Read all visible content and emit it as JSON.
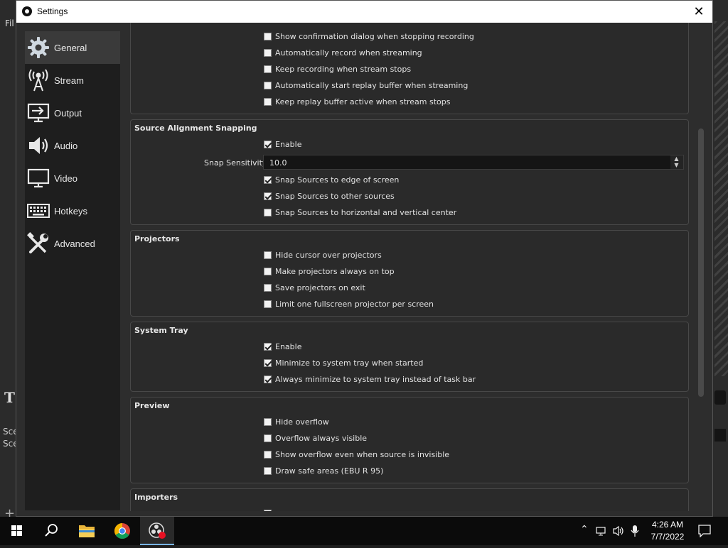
{
  "background_app": {
    "menu_fragment": "Fil",
    "scene_labels": [
      "Sce",
      "Sce"
    ],
    "text_tool_glyph": "T",
    "add_glyph": "+"
  },
  "window": {
    "title": "Settings",
    "close_glyph": "✕"
  },
  "sidebar": {
    "items": [
      {
        "label": "General",
        "icon": "gear-icon",
        "active": true
      },
      {
        "label": "Stream",
        "icon": "antenna-icon",
        "active": false
      },
      {
        "label": "Output",
        "icon": "output-icon",
        "active": false
      },
      {
        "label": "Audio",
        "icon": "speaker-icon",
        "active": false
      },
      {
        "label": "Video",
        "icon": "monitor-icon",
        "active": false
      },
      {
        "label": "Hotkeys",
        "icon": "keyboard-icon",
        "active": false
      },
      {
        "label": "Advanced",
        "icon": "tools-icon",
        "active": false
      }
    ]
  },
  "general": {
    "recording_checks": [
      {
        "label": "Show confirmation dialog when stopping recording",
        "checked": false
      },
      {
        "label": "Automatically record when streaming",
        "checked": false
      },
      {
        "label": "Keep recording when stream stops",
        "checked": false
      },
      {
        "label": "Automatically start replay buffer when streaming",
        "checked": false
      },
      {
        "label": "Keep replay buffer active when stream stops",
        "checked": false
      }
    ],
    "snapping": {
      "title": "Source Alignment Snapping",
      "enable": {
        "label": "Enable",
        "checked": true
      },
      "sensitivity_label": "Snap Sensitivity",
      "sensitivity_value": "10.0",
      "checks": [
        {
          "label": "Snap Sources to edge of screen",
          "checked": true
        },
        {
          "label": "Snap Sources to other sources",
          "checked": true
        },
        {
          "label": "Snap Sources to horizontal and vertical center",
          "checked": false
        }
      ]
    },
    "projectors": {
      "title": "Projectors",
      "checks": [
        {
          "label": "Hide cursor over projectors",
          "checked": false
        },
        {
          "label": "Make projectors always on top",
          "checked": false
        },
        {
          "label": "Save projectors on exit",
          "checked": false
        },
        {
          "label": "Limit one fullscreen projector per screen",
          "checked": false
        }
      ]
    },
    "system_tray": {
      "title": "System Tray",
      "checks": [
        {
          "label": "Enable",
          "checked": true
        },
        {
          "label": "Minimize to system tray when started",
          "checked": true
        },
        {
          "label": "Always minimize to system tray instead of task bar",
          "checked": true
        }
      ]
    },
    "preview": {
      "title": "Preview",
      "checks": [
        {
          "label": "Hide overflow",
          "checked": false
        },
        {
          "label": "Overflow always visible",
          "checked": false
        },
        {
          "label": "Show overflow even when source is invisible",
          "checked": false
        },
        {
          "label": "Draw safe areas (EBU R 95)",
          "checked": false
        }
      ]
    },
    "importers": {
      "title": "Importers"
    }
  },
  "taskbar": {
    "apps": [
      "start-icon",
      "search-icon",
      "file-explorer-icon",
      "chrome-icon",
      "obs-icon"
    ],
    "clock_time": "4:26 AM",
    "clock_date": "7/7/2022",
    "colors": {
      "accent": "#79b5e6",
      "taskbar_bg": "#0b0b0b"
    }
  }
}
